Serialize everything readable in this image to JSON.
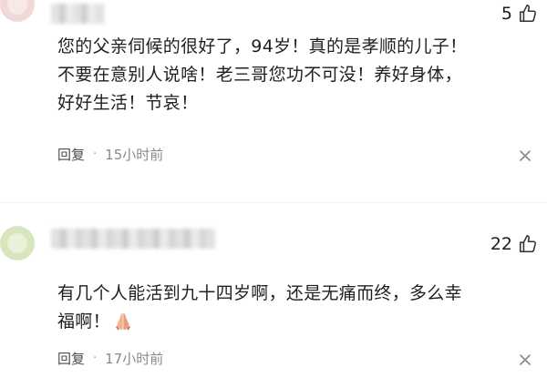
{
  "comments": [
    {
      "like_count": "5",
      "text_lines": [
        "您的父亲伺候的很好了，94岁！真的是孝顺的儿子！",
        "不要在意别人说啥！老三哥您功不可没！养好身体，",
        "好好生活！节哀！"
      ],
      "reply_label": "回复",
      "separator": "·",
      "time": "15小时前"
    },
    {
      "like_count": "22",
      "text_lines": [
        "有几个人能活到九十四岁啊，还是无痛而终，多么幸",
        "福啊！"
      ],
      "reply_label": "回复",
      "separator": "·",
      "time": "17小时前"
    }
  ],
  "icons": [
    "thumbs-up-icon",
    "pray-emoji-icon",
    "close-x-icon"
  ]
}
